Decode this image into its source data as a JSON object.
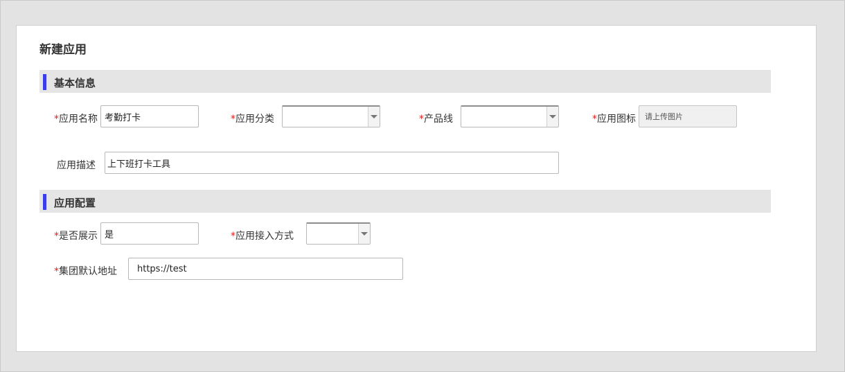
{
  "page": {
    "title": "新建应用"
  },
  "sections": {
    "basic": {
      "label": "基本信息"
    },
    "config": {
      "label": "应用配置"
    }
  },
  "fields": {
    "app_name": {
      "required": true,
      "label": "应用名称",
      "value": "考勤打卡"
    },
    "app_category": {
      "required": true,
      "label": "应用分类",
      "value": ""
    },
    "product_line": {
      "required": true,
      "label": "产品线",
      "value": ""
    },
    "app_icon": {
      "required": true,
      "label": "应用图标",
      "placeholder": "请上传图片"
    },
    "app_description": {
      "required": false,
      "label": "应用描述",
      "value": "上下班打卡工具"
    },
    "display": {
      "required": true,
      "label": "是否展示",
      "value": "是"
    },
    "access_mode": {
      "required": true,
      "label": "应用接入方式",
      "value": ""
    },
    "group_default_url": {
      "required": true,
      "label": "集团默认地址",
      "value": "https://test"
    }
  },
  "required_mark": "*",
  "colors": {
    "accent": "#3a3dec",
    "required": "#e41b1b",
    "section_bg": "#e5e5e5"
  }
}
